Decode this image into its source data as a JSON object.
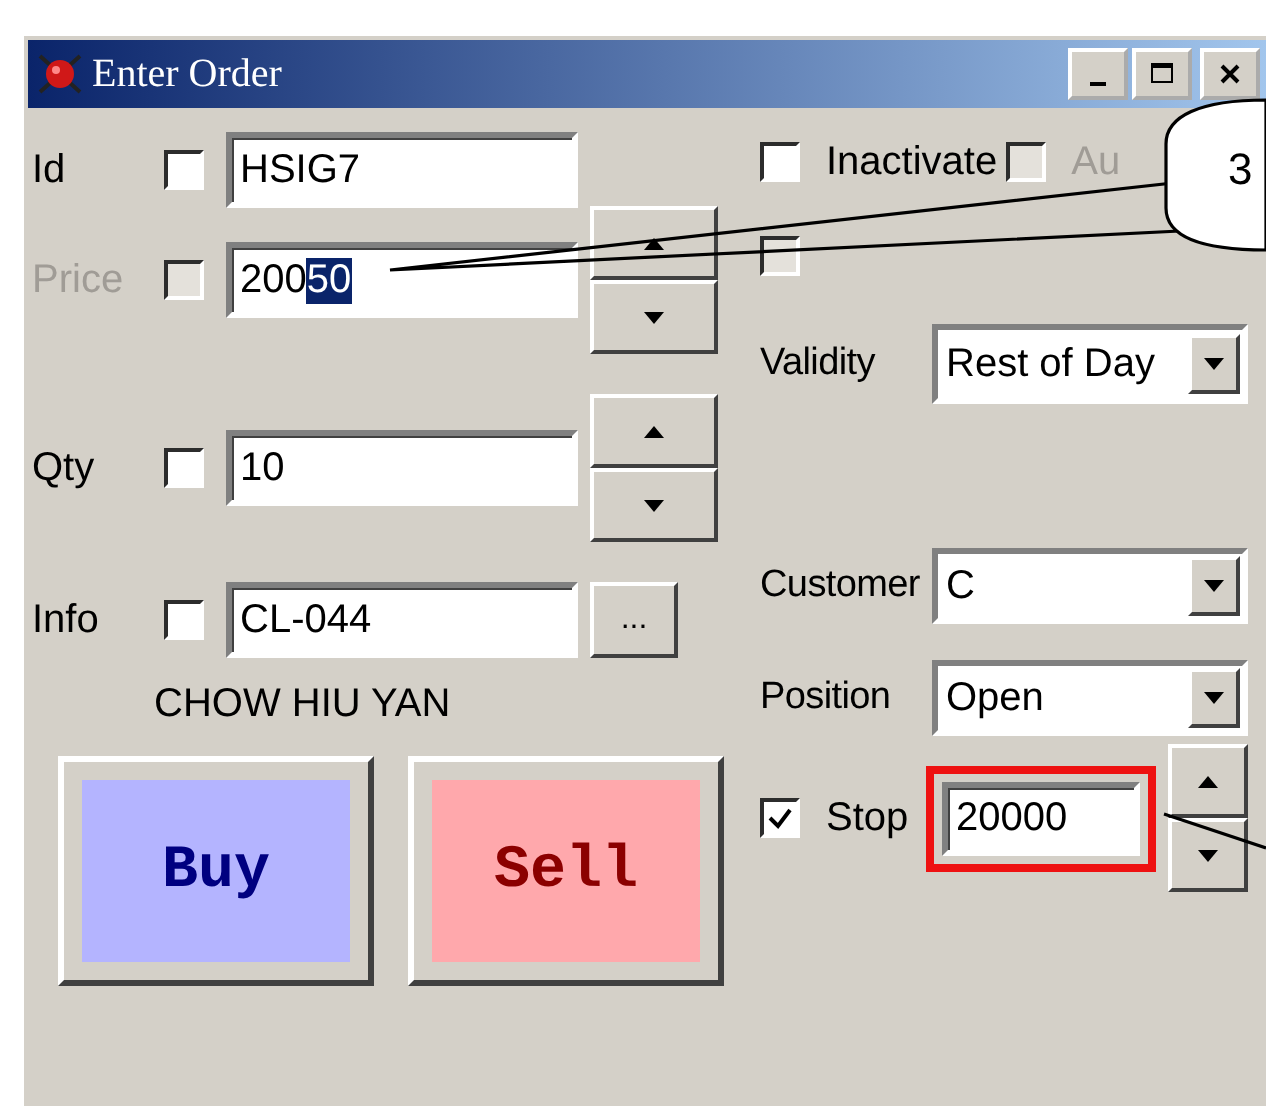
{
  "window": {
    "title": "Enter Order"
  },
  "fields": [
    {
      "label": "Id",
      "kind": "text",
      "disabled": false,
      "checked": false,
      "value": "HSIG7"
    },
    {
      "label": "Price",
      "kind": "spin",
      "disabled": true,
      "checked": false,
      "value": "200",
      "selected_value": "50"
    },
    {
      "label": "Qty",
      "kind": "spin",
      "disabled": false,
      "checked": false,
      "value": "10"
    },
    {
      "label": "Info",
      "kind": "lookup",
      "disabled": false,
      "checked": false,
      "value": "CL-044",
      "button": "..."
    }
  ],
  "customer_name": "CHOW HIU YAN",
  "buttons": [
    {
      "label": "Buy",
      "kind": "buy"
    },
    {
      "label": "Sell",
      "kind": "sell"
    }
  ],
  "options": [
    {
      "label": "Inactivate",
      "checked": false,
      "disabled": false
    },
    {
      "label": "Au",
      "checked": false,
      "disabled": true
    }
  ],
  "order_alert": {
    "disabled": true
  },
  "combos": [
    {
      "label": "Validity",
      "value": "Rest of Day"
    },
    {
      "label": "Customer",
      "value": "C"
    },
    {
      "label": "Position",
      "value": "Open"
    }
  ],
  "stop": {
    "label": "Stop",
    "checked": true,
    "value": "20000",
    "highlighted": true
  },
  "callout": {
    "text": "3"
  }
}
